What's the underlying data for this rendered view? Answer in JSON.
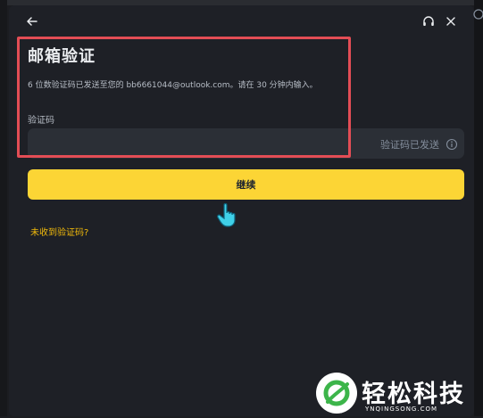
{
  "header": {
    "back_icon": "arrow-left-icon",
    "support_icon": "headset-icon",
    "close_icon": "close-icon"
  },
  "form": {
    "title": "邮箱验证",
    "subtitle": "6 位数验证码已发送至您的 bb6661044@outlook.com。请在 30 分钟内输入。",
    "code_label": "验证码",
    "code_value": "",
    "code_placeholder": "",
    "sent_status": "验证码已发送",
    "continue_label": "继续",
    "resend_link": "未收到验证码?"
  },
  "colors": {
    "accent": "#fcd535",
    "link": "#f0b90b",
    "highlight_border": "#e34d55",
    "background": "#1e2026",
    "field_bg": "#2b2f36"
  },
  "watermark": {
    "text": "轻松科技",
    "subtext": "YNQINGSONG.COM"
  }
}
